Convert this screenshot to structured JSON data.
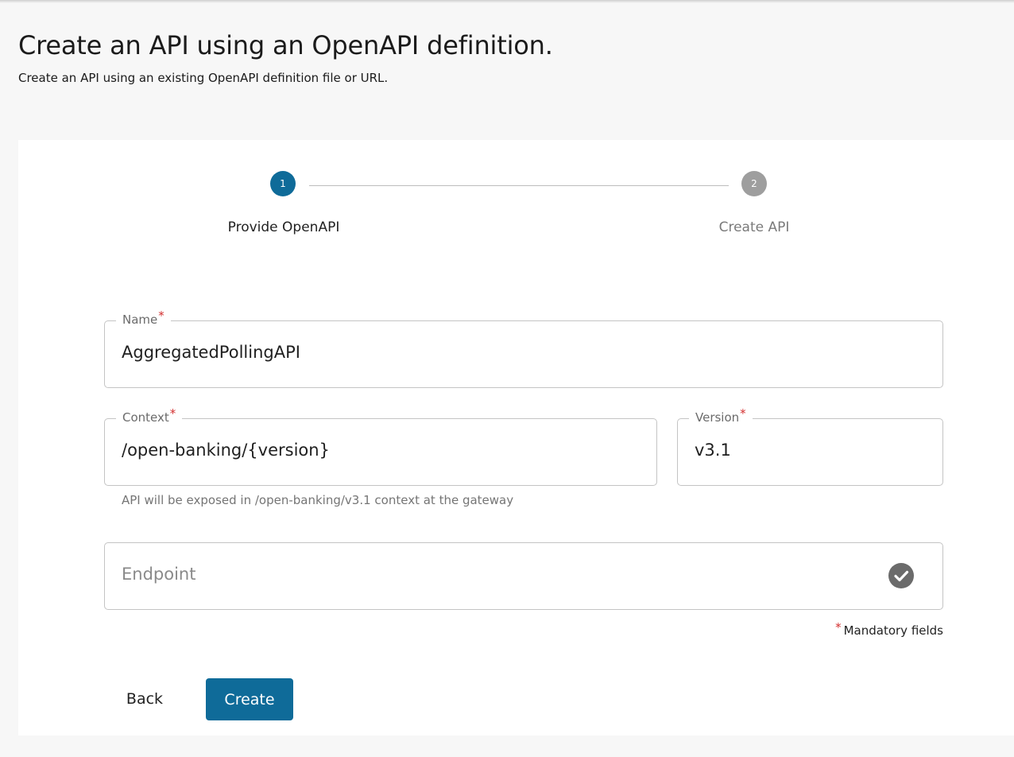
{
  "header": {
    "title": "Create an API using an OpenAPI definition.",
    "subtitle": "Create an API using an existing OpenAPI definition file or URL."
  },
  "stepper": {
    "steps": [
      {
        "number": "1",
        "label": "Provide OpenAPI",
        "state": "active"
      },
      {
        "number": "2",
        "label": "Create API",
        "state": "inactive"
      }
    ]
  },
  "form": {
    "name": {
      "label": "Name",
      "required_mark": "*",
      "value": "AggregatedPollingAPI"
    },
    "context": {
      "label": "Context",
      "required_mark": "*",
      "value": "/open-banking/{version}"
    },
    "version": {
      "label": "Version",
      "required_mark": "*",
      "value": "v3.1"
    },
    "context_helper": "API will be exposed in /open-banking/v3.1 context at the gateway",
    "endpoint": {
      "placeholder": "Endpoint",
      "status_icon": "check-circle-icon"
    },
    "mandatory_note": {
      "mark": "*",
      "text": "Mandatory fields"
    }
  },
  "actions": {
    "back_label": "Back",
    "create_label": "Create"
  },
  "colors": {
    "primary": "#0f6b99",
    "inactive_step": "#9e9e9e",
    "required": "#d32f2f"
  }
}
